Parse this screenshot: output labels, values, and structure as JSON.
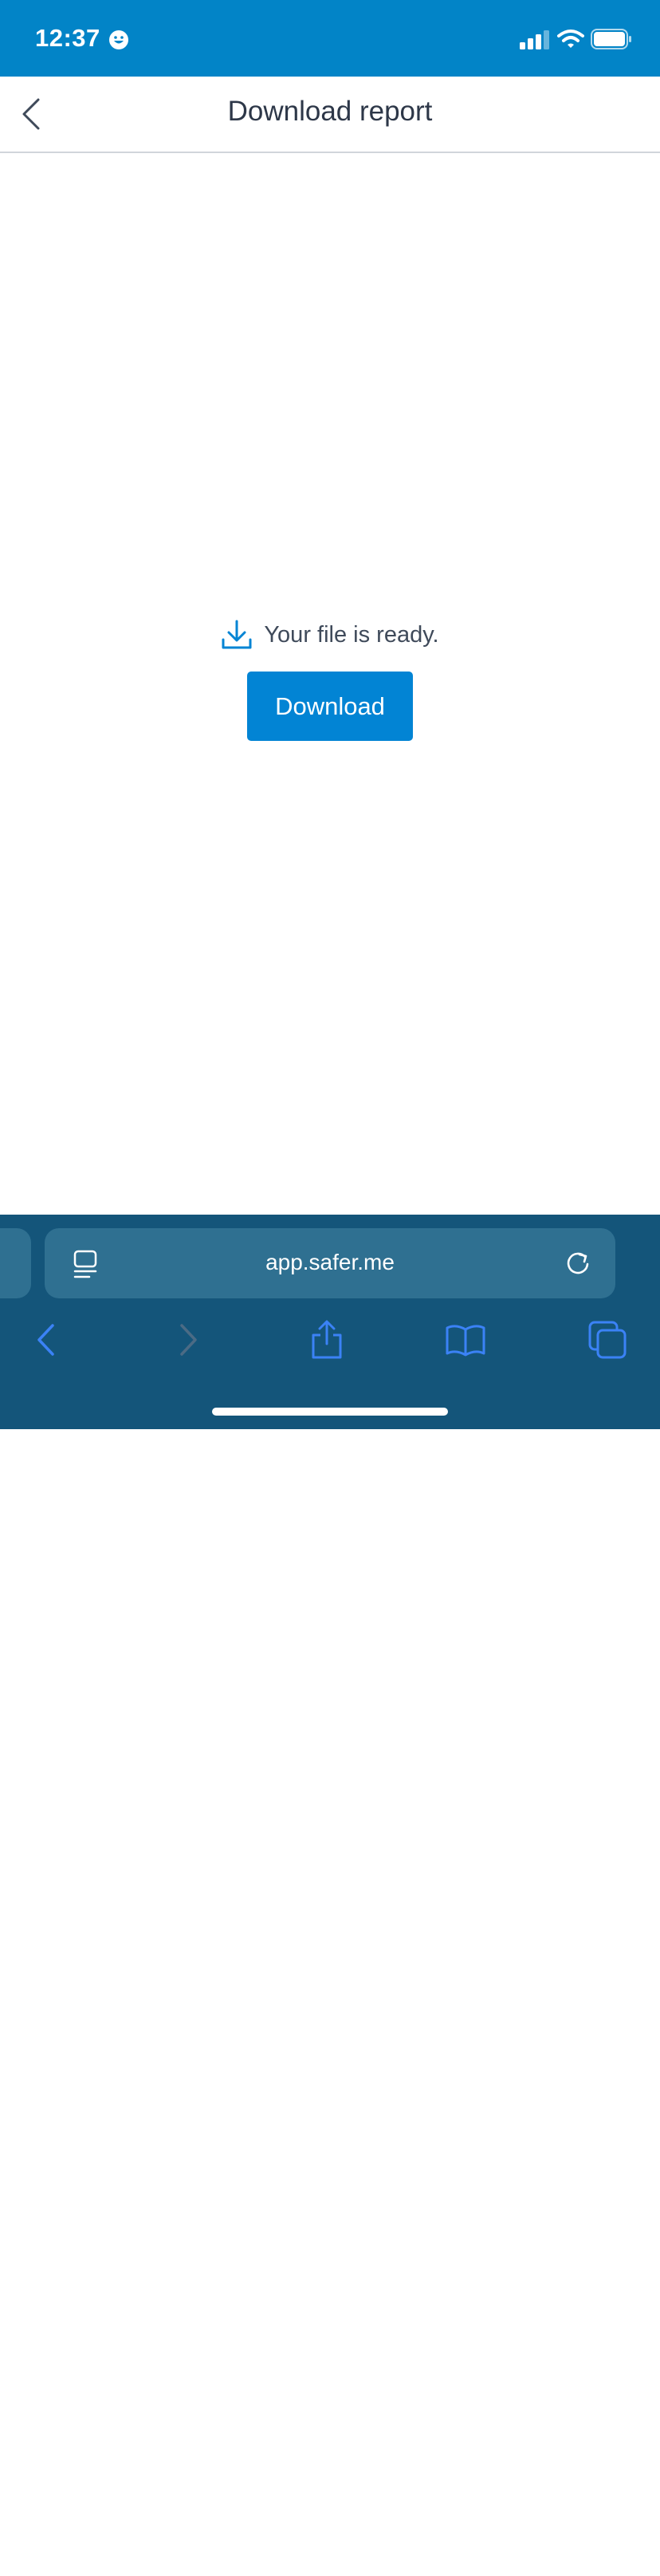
{
  "status_bar": {
    "time": "12:37",
    "background": "#0284c7"
  },
  "header": {
    "title": "Download report"
  },
  "main": {
    "ready_text": "Your file is ready.",
    "download_label": "Download",
    "accent": "#0284d4"
  },
  "browser": {
    "address": "app.safer.me",
    "background": "#14557a"
  },
  "icons": {
    "back": "chevron-left-icon",
    "download": "download-icon",
    "page_menu": "page-menu-icon",
    "reload": "reload-icon",
    "nav_back": "chevron-left-icon",
    "nav_forward": "chevron-right-icon",
    "share": "share-icon",
    "bookmarks": "book-icon",
    "tabs": "tabs-icon"
  }
}
